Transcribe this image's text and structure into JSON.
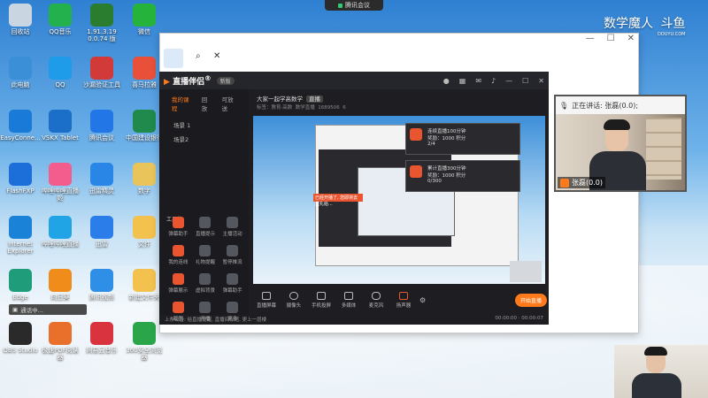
{
  "meeting_bar": {
    "label": "腾讯会议"
  },
  "brand": {
    "name": "数学魔人",
    "site": "斗鱼",
    "url_text": "DOUYU.COM"
  },
  "desktop_icons": [
    {
      "label": "回收站",
      "color": "#c9d6e2"
    },
    {
      "label": "QQ音乐",
      "color": "#22b14c"
    },
    {
      "label": "1.91.3.19 0.0.74 版",
      "color": "#2a7d2e"
    },
    {
      "label": "微信",
      "color": "#26b33b"
    },
    {
      "label": "此电脑",
      "color": "#3b8fd6"
    },
    {
      "label": "QQ",
      "color": "#1e9be9"
    },
    {
      "label": "沙漏验证工具",
      "color": "#d23a3a"
    },
    {
      "label": "喜马拉雅",
      "color": "#e8503a"
    },
    {
      "label": "EasyConne...",
      "color": "#1a7ad8"
    },
    {
      "label": "VSKX Tablet",
      "color": "#1b6fc9"
    },
    {
      "label": "腾讯会议",
      "color": "#2376e6"
    },
    {
      "label": "中国建设银行",
      "color": "#1f8a4c"
    },
    {
      "label": "FlashFXP",
      "color": "#1c6fd8"
    },
    {
      "label": "哔哩哔哩直播姬",
      "color": "#f25d8e"
    },
    {
      "label": "迅雷精灵",
      "color": "#2a86e6"
    },
    {
      "label": "数字",
      "color": "#e8c45a"
    },
    {
      "label": "Internet Explorer",
      "color": "#1a83d8"
    },
    {
      "label": "哔哩哔哩直播",
      "color": "#21a4e6"
    },
    {
      "label": "迅雷",
      "color": "#2b7de9"
    },
    {
      "label": "文件",
      "color": "#f2c14e"
    },
    {
      "label": "Edge",
      "color": "#1f9d7a"
    },
    {
      "label": "向日葵",
      "color": "#f08c1a"
    },
    {
      "label": "腾讯视频",
      "color": "#2f8fe6"
    },
    {
      "label": "新建文件夹",
      "color": "#f2c14e"
    },
    {
      "label": "OBS Studio",
      "color": "#2a2a2a"
    },
    {
      "label": "极速PDF阅读器",
      "color": "#e8702a"
    },
    {
      "label": "网易云音乐",
      "color": "#d9333f"
    },
    {
      "label": "360安全浏览器",
      "color": "#2aa54a"
    }
  ],
  "app": {
    "name": "直播伴侣",
    "name_accent": "®",
    "badge": "新版",
    "left_tabs": [
      "我的课程",
      "回放",
      "可放送"
    ],
    "scenes": [
      "场景 1",
      "场景2"
    ],
    "tools_label": "工具箱",
    "tools": [
      "弹幕助手",
      "直播提示",
      "主播活动",
      "我的连线",
      "礼物提醒",
      "暂停推流",
      "弹幕展示",
      "虚拟背景",
      "弹幕助手",
      "截图",
      "开播",
      "更多"
    ],
    "bottom_info": "上条公告: 给直播提醒, 直播间标题, 更上一层楼",
    "title": "大家一起学高数学",
    "title_tag": "直播",
    "meta": [
      "标签：教育·高数",
      "数学直播",
      "1689506",
      "6"
    ],
    "popups": [
      {
        "title": "连续直播100分钟",
        "line1": "奖励：1000 积分",
        "line2": "2/4"
      },
      {
        "title": "累计直播300分钟",
        "line1": "奖励：1000 积分",
        "line2": "0/300"
      }
    ],
    "orange_tip": "已经开播了, 您即将去送礼给...",
    "controls": [
      "直播屏幕",
      "摄像头",
      "手机投屏",
      "多媒体",
      "麦克风",
      "扬声器"
    ],
    "go_live": "开始直播",
    "timers": [
      "00:00:00",
      "00:00:07"
    ]
  },
  "speaker": {
    "label": "正在讲话: 张磊(0.0);",
    "name": "张磊(0.0)"
  },
  "tooltip": {
    "text": "通话中..."
  }
}
